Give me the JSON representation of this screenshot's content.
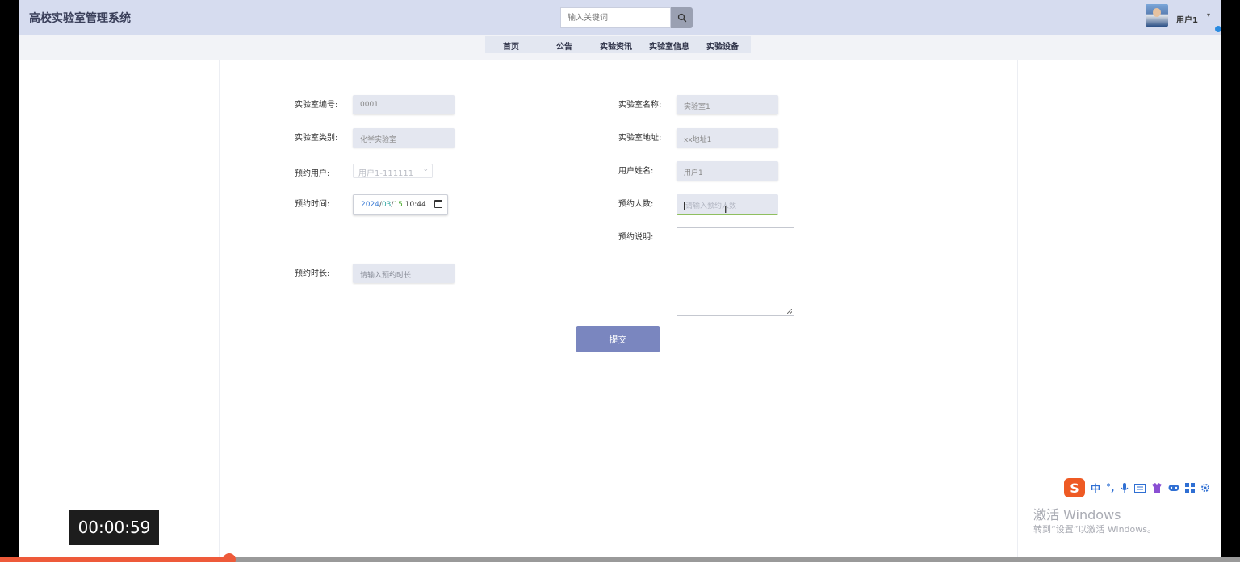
{
  "header": {
    "app_title": "高校实验室管理系统",
    "search_placeholder": "输入关键词",
    "user_name": "用户1",
    "caret": "▾"
  },
  "nav": {
    "items": [
      "首页",
      "公告",
      "实验资讯",
      "实验室信息",
      "实验设备"
    ]
  },
  "form": {
    "lab_no": {
      "label": "实验室编号:",
      "value": "0001"
    },
    "lab_name": {
      "label": "实验室名称:",
      "value": "实验室1"
    },
    "lab_type": {
      "label": "实验室类别:",
      "value": "化学实验室"
    },
    "lab_address": {
      "label": "实验室地址:",
      "value": "xx地址1"
    },
    "booking_user": {
      "label": "预约用户:",
      "value": "用户1-111111"
    },
    "user_fullname": {
      "label": "用户姓名:",
      "value": "用户1"
    },
    "booking_time": {
      "label": "预约时间:",
      "year": "2024",
      "month": "03",
      "day": "15",
      "time": "10:44"
    },
    "booking_count": {
      "label": "预约人数:",
      "placeholder": "请输入预约人数"
    },
    "booking_note": {
      "label": "预约说明:"
    },
    "booking_duration": {
      "label": "预约时长:",
      "placeholder": "请输入预约时长"
    },
    "submit_label": "提交"
  },
  "ime": {
    "mode": "中",
    "punct": "°,",
    "icons": [
      "sogou-logo-icon",
      "microphone-icon",
      "keyboard-icon",
      "skin-icon",
      "gamepad-icon",
      "grid-icon",
      "settings-icon"
    ]
  },
  "watermark": {
    "line1": "激活 Windows",
    "line2": "转到“设置”以激活 Windows。"
  },
  "player": {
    "timestamp": "00:00:59",
    "progress_fraction": 0.185
  },
  "colors": {
    "header_bg": "#d6dcef",
    "submit_bg": "#7a86bf",
    "progress": "#ee5a3a"
  }
}
